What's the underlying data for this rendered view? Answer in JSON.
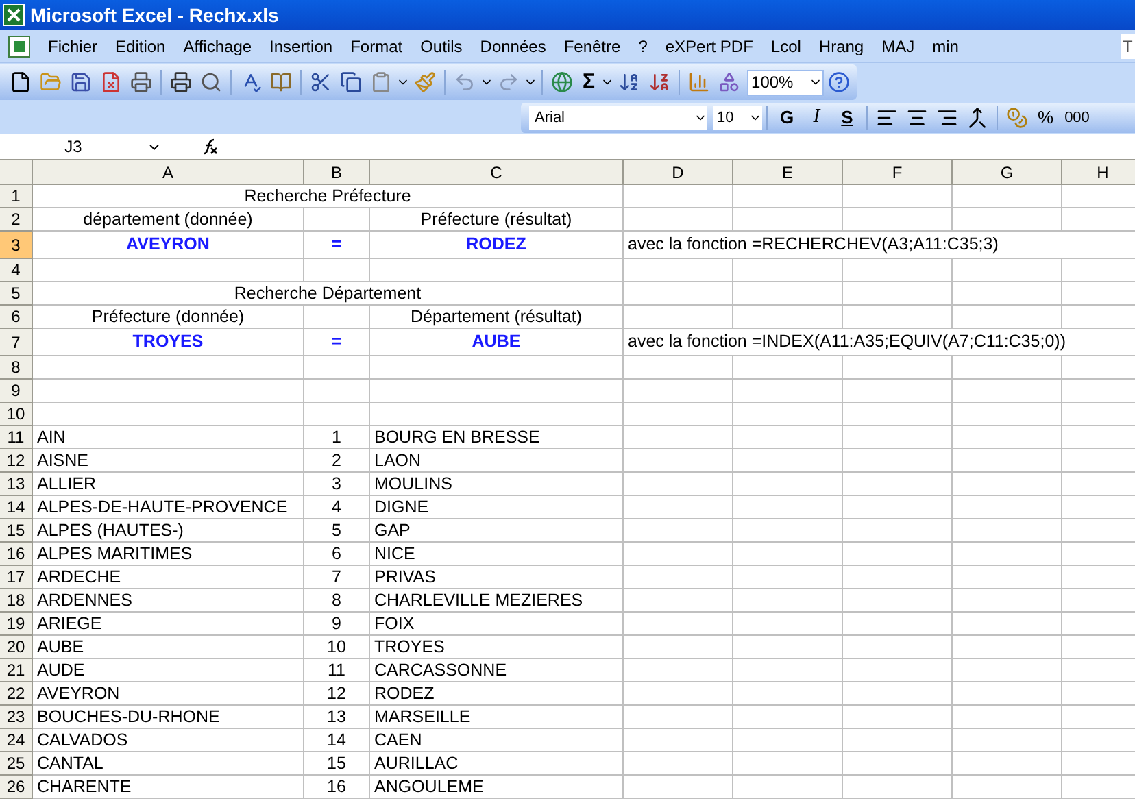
{
  "window": {
    "title": "Microsoft Excel - Rechx.xls"
  },
  "menu": [
    "Fichier",
    "Edition",
    "Affichage",
    "Insertion",
    "Format",
    "Outils",
    "Données",
    "Fenêtre",
    "?",
    "eXPert PDF",
    "Lcol",
    "Hrang",
    "MAJ",
    "min"
  ],
  "help_field": {
    "placeholder": "T"
  },
  "standard_toolbar": {
    "sum": "Σ",
    "zoom": "100%"
  },
  "format_toolbar": {
    "font": "Arial",
    "size": "10",
    "bold": "G",
    "italic": "I",
    "underline": "S",
    "percent": "%",
    "thousands": "000"
  },
  "formula_bar": {
    "name_box": "J3"
  },
  "grid": {
    "columns": [
      "A",
      "B",
      "C",
      "D",
      "E",
      "F",
      "G",
      "H"
    ],
    "rows": [
      {
        "number": "1",
        "selected": false,
        "kind": "title",
        "a": "Recherche Préfecture"
      },
      {
        "number": "2",
        "selected": false,
        "kind": "heading",
        "a": "département (donnée)",
        "c": "Préfecture (résultat)"
      },
      {
        "number": "3",
        "selected": true,
        "kind": "result",
        "a": "AVEYRON",
        "b": "=",
        "c": "RODEZ",
        "d": "avec la fonction =RECHERCHEV(A3;A11:C35;3)"
      },
      {
        "number": "4",
        "selected": false,
        "kind": "list"
      },
      {
        "number": "5",
        "selected": false,
        "kind": "title",
        "a": "Recherche Département"
      },
      {
        "number": "6",
        "selected": false,
        "kind": "heading",
        "a": "Préfecture (donnée)",
        "c": "Département (résultat)"
      },
      {
        "number": "7",
        "selected": false,
        "kind": "result",
        "a": "TROYES",
        "b": "=",
        "c": "AUBE",
        "d": "avec la fonction =INDEX(A11:A35;EQUIV(A7;C11:C35;0))"
      },
      {
        "number": "8",
        "selected": false,
        "kind": "list"
      },
      {
        "number": "9",
        "selected": false,
        "kind": "list"
      },
      {
        "number": "10",
        "selected": false,
        "kind": "list"
      },
      {
        "number": "11",
        "selected": false,
        "kind": "list",
        "a": "AIN",
        "b": "1",
        "c": "BOURG EN BRESSE"
      },
      {
        "number": "12",
        "selected": false,
        "kind": "list",
        "a": "AISNE",
        "b": "2",
        "c": "LAON"
      },
      {
        "number": "13",
        "selected": false,
        "kind": "list",
        "a": "ALLIER",
        "b": "3",
        "c": "MOULINS"
      },
      {
        "number": "14",
        "selected": false,
        "kind": "list",
        "a": "ALPES-DE-HAUTE-PROVENCE",
        "b": "4",
        "c": "DIGNE"
      },
      {
        "number": "15",
        "selected": false,
        "kind": "list",
        "a": "ALPES (HAUTES-)",
        "b": "5",
        "c": "GAP"
      },
      {
        "number": "16",
        "selected": false,
        "kind": "list",
        "a": "ALPES MARITIMES",
        "b": "6",
        "c": "NICE"
      },
      {
        "number": "17",
        "selected": false,
        "kind": "list",
        "a": "ARDECHE",
        "b": "7",
        "c": "PRIVAS"
      },
      {
        "number": "18",
        "selected": false,
        "kind": "list",
        "a": "ARDENNES",
        "b": "8",
        "c": "CHARLEVILLE MEZIERES"
      },
      {
        "number": "19",
        "selected": false,
        "kind": "list",
        "a": "ARIEGE",
        "b": "9",
        "c": "FOIX"
      },
      {
        "number": "20",
        "selected": false,
        "kind": "list",
        "a": "AUBE",
        "b": "10",
        "c": "TROYES"
      },
      {
        "number": "21",
        "selected": false,
        "kind": "list",
        "a": "AUDE",
        "b": "11",
        "c": "CARCASSONNE"
      },
      {
        "number": "22",
        "selected": false,
        "kind": "list",
        "a": "AVEYRON",
        "b": "12",
        "c": "RODEZ"
      },
      {
        "number": "23",
        "selected": false,
        "kind": "list",
        "a": "BOUCHES-DU-RHONE",
        "b": "13",
        "c": "MARSEILLE"
      },
      {
        "number": "24",
        "selected": false,
        "kind": "list",
        "a": "CALVADOS",
        "b": "14",
        "c": "CAEN"
      },
      {
        "number": "25",
        "selected": false,
        "kind": "list",
        "a": "CANTAL",
        "b": "15",
        "c": "AURILLAC"
      },
      {
        "number": "26",
        "selected": false,
        "kind": "list",
        "a": "CHARENTE",
        "b": "16",
        "c": "ANGOULEME"
      }
    ]
  }
}
